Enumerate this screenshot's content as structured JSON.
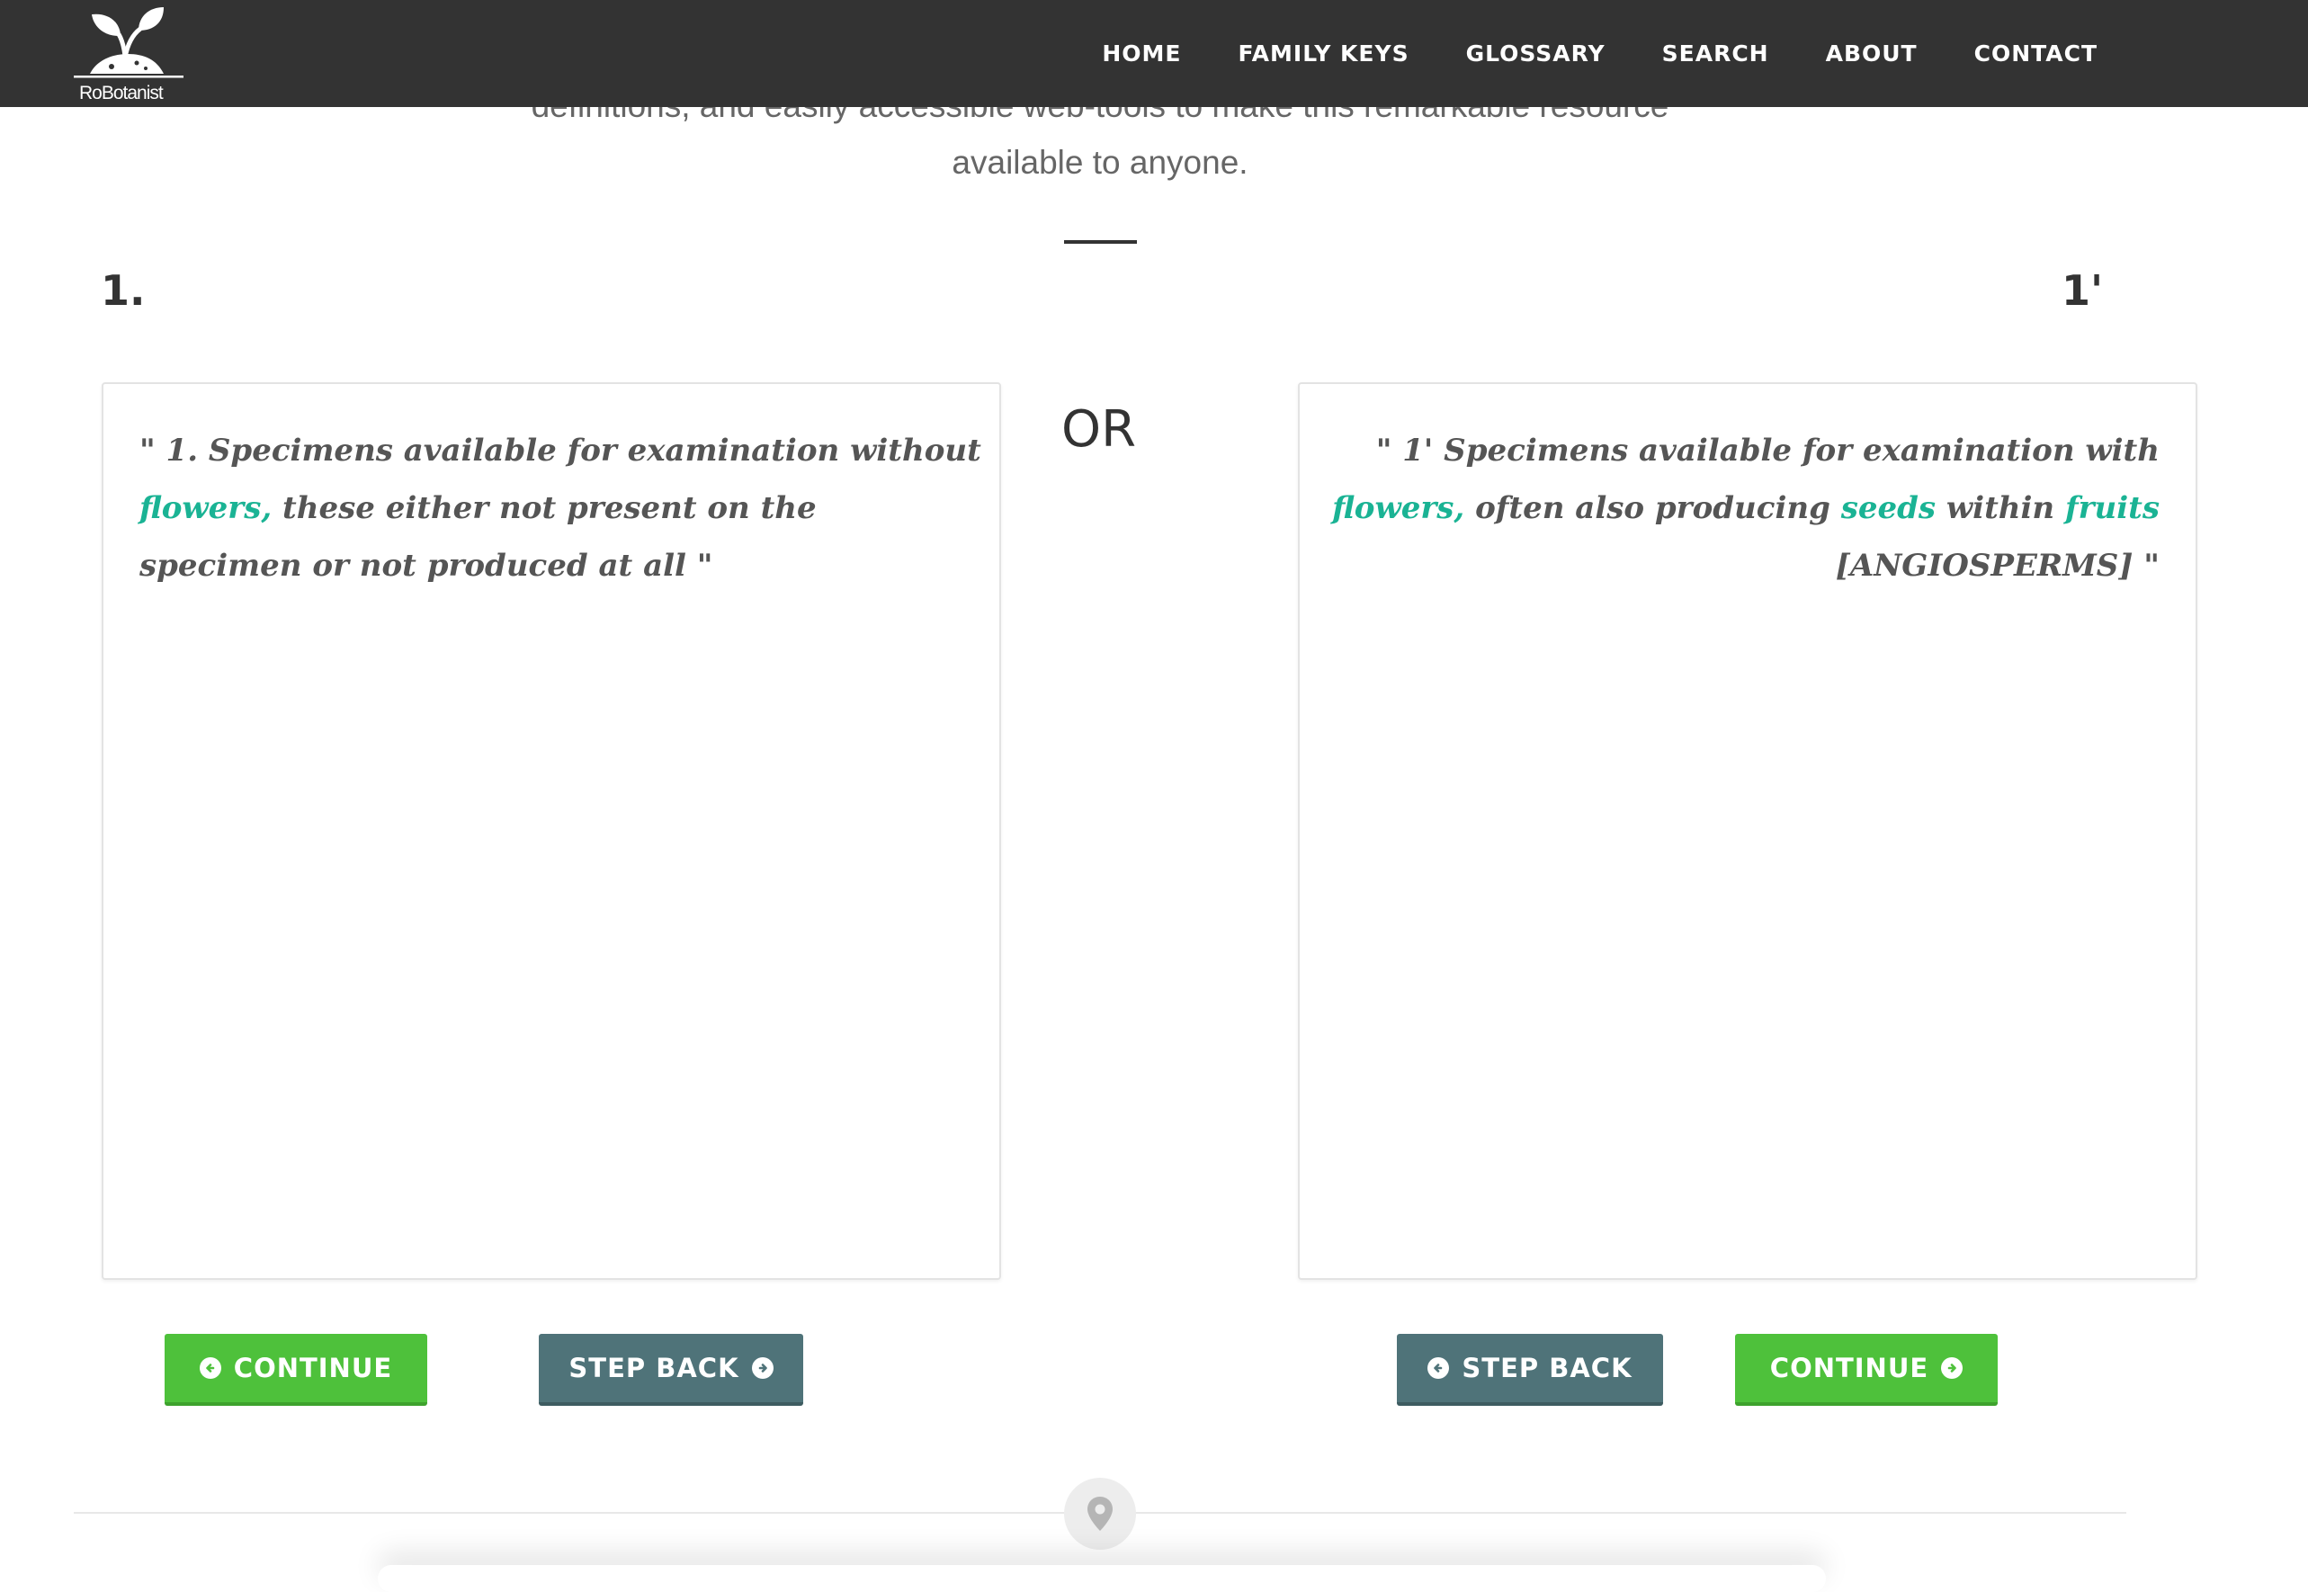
{
  "header": {
    "logo_text": "RoBotanist",
    "nav": [
      "HOME",
      "FAMILY KEYS",
      "GLOSSARY",
      "SEARCH",
      "ABOUT",
      "CONTACT"
    ]
  },
  "intro": {
    "line1": "definitions, and easily accessible web-tools to make this remarkable resource",
    "line2": "available to anyone."
  },
  "couplet": {
    "left_number": "1.",
    "right_number": "1'",
    "or_label": "OR",
    "left": {
      "parts": [
        {
          "text": "\" 1. Specimens available for examination without ",
          "term": false
        },
        {
          "text": "flowers,",
          "term": true
        },
        {
          "text": " these either not present on the specimen or not produced at all \"",
          "term": false
        }
      ]
    },
    "right": {
      "parts": [
        {
          "text": "\" 1' Specimens available for examination with ",
          "term": false
        },
        {
          "text": "flowers,",
          "term": true
        },
        {
          "text": " often also producing ",
          "term": false
        },
        {
          "text": "seeds",
          "term": true
        },
        {
          "text": " within ",
          "term": false
        },
        {
          "text": "fruits",
          "term": true
        },
        {
          "text": " [ANGIOSPERMS] \"",
          "term": false
        }
      ]
    }
  },
  "buttons": {
    "left_continue": "CONTINUE",
    "left_step_back": "STEP BACK",
    "right_step_back": "STEP BACK",
    "right_continue": "CONTINUE"
  },
  "colors": {
    "header_bg": "#333333",
    "term": "#1ab394",
    "continue_button": "#4ec13b",
    "step_back_button": "#4f7379"
  },
  "icons": {
    "left_continue": "arrow-circle-left-icon",
    "left_step_back": "arrow-circle-right-icon",
    "right_step_back": "arrow-circle-left-icon",
    "right_continue": "arrow-circle-right-icon",
    "footer": "map-marker-icon"
  }
}
